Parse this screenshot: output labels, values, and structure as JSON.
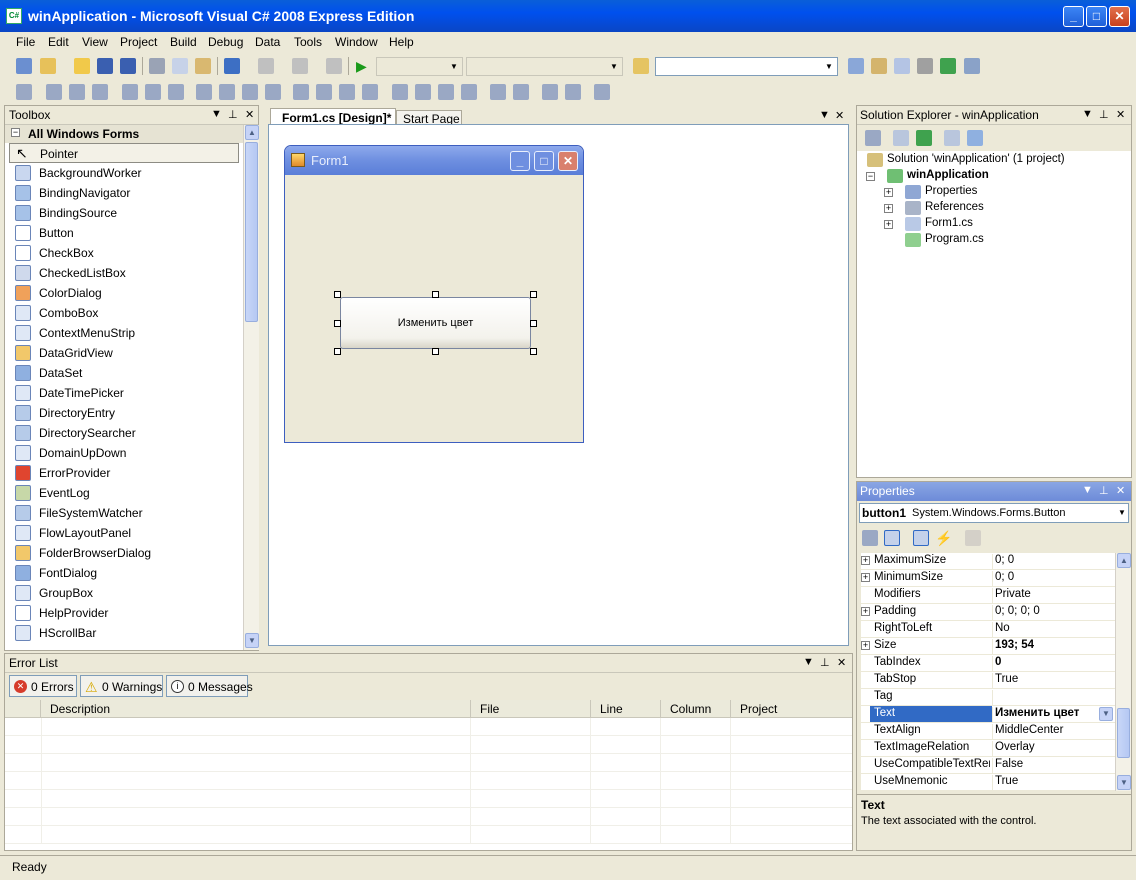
{
  "window": {
    "title": "winApplication - Microsoft Visual C# 2008 Express Edition"
  },
  "menu": [
    "File",
    "Edit",
    "View",
    "Project",
    "Build",
    "Debug",
    "Data",
    "Tools",
    "Window",
    "Help"
  ],
  "toolbox": {
    "title": "Toolbox",
    "category": "All Windows Forms",
    "items": [
      "Pointer",
      "BackgroundWorker",
      "BindingNavigator",
      "BindingSource",
      "Button",
      "CheckBox",
      "CheckedListBox",
      "ColorDialog",
      "ComboBox",
      "ContextMenuStrip",
      "DataGridView",
      "DataSet",
      "DateTimePicker",
      "DirectoryEntry",
      "DirectorySearcher",
      "DomainUpDown",
      "ErrorProvider",
      "EventLog",
      "FileSystemWatcher",
      "FlowLayoutPanel",
      "FolderBrowserDialog",
      "FontDialog",
      "GroupBox",
      "HelpProvider",
      "HScrollBar"
    ]
  },
  "tabs": {
    "active": "Form1.cs [Design]*",
    "other": "Start Page"
  },
  "form": {
    "title": "Form1",
    "button_text": "Изменить цвет"
  },
  "errorlist": {
    "title": "Error List",
    "errors": "0 Errors",
    "warnings": "0 Warnings",
    "messages": "0 Messages",
    "columns": [
      "Description",
      "File",
      "Line",
      "Column",
      "Project"
    ]
  },
  "solution": {
    "title": "Solution Explorer - winApplication",
    "root": "Solution 'winApplication' (1 project)",
    "project": "winApplication",
    "items": [
      "Properties",
      "References",
      "Form1.cs",
      "Program.cs"
    ]
  },
  "properties": {
    "title": "Properties",
    "object_name": "button1",
    "object_type": "System.Windows.Forms.Button",
    "rows": [
      {
        "name": "MaximumSize",
        "value": "0; 0",
        "expand": true,
        "bold": false
      },
      {
        "name": "MinimumSize",
        "value": "0; 0",
        "expand": true,
        "bold": false
      },
      {
        "name": "Modifiers",
        "value": "Private",
        "expand": false,
        "bold": false
      },
      {
        "name": "Padding",
        "value": "0; 0; 0; 0",
        "expand": true,
        "bold": false
      },
      {
        "name": "RightToLeft",
        "value": "No",
        "expand": false,
        "bold": false
      },
      {
        "name": "Size",
        "value": "193; 54",
        "expand": true,
        "bold": true
      },
      {
        "name": "TabIndex",
        "value": "0",
        "expand": false,
        "bold": true
      },
      {
        "name": "TabStop",
        "value": "True",
        "expand": false,
        "bold": false
      },
      {
        "name": "Tag",
        "value": "",
        "expand": false,
        "bold": false
      },
      {
        "name": "Text",
        "value": "Изменить цвет",
        "expand": false,
        "bold": true,
        "selected": true
      },
      {
        "name": "TextAlign",
        "value": "MiddleCenter",
        "expand": false,
        "bold": false
      },
      {
        "name": "TextImageRelation",
        "value": "Overlay",
        "expand": false,
        "bold": false
      },
      {
        "name": "UseCompatibleTextRendering",
        "value": "False",
        "expand": false,
        "bold": false
      },
      {
        "name": "UseMnemonic",
        "value": "True",
        "expand": false,
        "bold": false
      }
    ],
    "desc_title": "Text",
    "desc_text": "The text associated with the control."
  },
  "status": {
    "text": "Ready"
  },
  "colors": {
    "title_bar": "#0050ee",
    "selection": "#316ac5",
    "form_caption": "#7b98e4"
  }
}
